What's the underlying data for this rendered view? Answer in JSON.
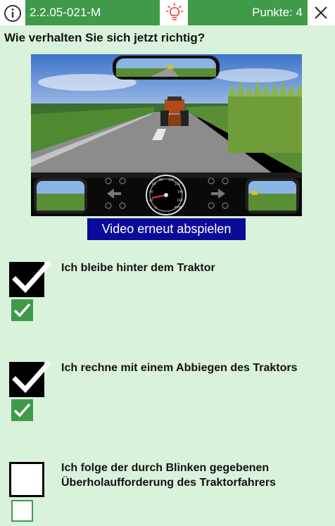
{
  "header": {
    "question_id": "2.2.05-021-M",
    "points": "Punkte: 4",
    "info_icon": "info-icon",
    "hint_icon": "lightbulb-icon",
    "close_icon": "close-icon"
  },
  "question": {
    "text": "Wie verhalten Sie sich jetzt richtig?"
  },
  "video": {
    "replay_label": "Video erneut abspielen",
    "speedometer_unit": "km/h",
    "speed_ticks": [
      "0",
      "20",
      "40",
      "60",
      "80",
      "100",
      "120",
      "140",
      "160"
    ]
  },
  "answers": [
    {
      "text": "Ich bleibe hinter dem Traktor",
      "selected": true,
      "correct": true
    },
    {
      "text": "Ich rechne mit einem Abbiegen des Traktors",
      "selected": true,
      "correct": true
    },
    {
      "text": "Ich folge der durch Blinken gegebenen Überholaufforderung des Traktorfahrers",
      "selected": false,
      "correct": false
    }
  ],
  "colors": {
    "background": "#d9f2dc",
    "header_green": "#3f9a4a",
    "button_blue": "#0b0b9a",
    "bulb_red": "#e53935"
  }
}
